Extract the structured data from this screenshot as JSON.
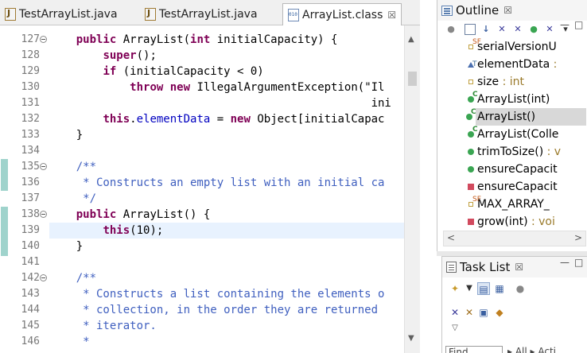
{
  "editor": {
    "tabs": [
      {
        "label": "TestArrayList.java",
        "icon": "java-file-icon",
        "active": false
      },
      {
        "label": "TestArrayList.java",
        "icon": "java-file-icon",
        "active": false
      },
      {
        "label": "ArrayList.class",
        "icon": "class-file-icon",
        "active": true,
        "close_glyph": "☒"
      }
    ],
    "lines": [
      {
        "num": "127",
        "fold": true,
        "tokens": [
          [
            "",
            "    "
          ],
          [
            "kw",
            "public"
          ],
          [
            "",
            " ArrayList("
          ],
          [
            "kw",
            "int"
          ],
          [
            "",
            " initialCapacity) {"
          ]
        ]
      },
      {
        "num": "128",
        "tokens": [
          [
            "",
            "        "
          ],
          [
            "kw",
            "super"
          ],
          [
            "",
            "();"
          ]
        ]
      },
      {
        "num": "129",
        "tokens": [
          [
            "",
            "        "
          ],
          [
            "kw",
            "if"
          ],
          [
            "",
            " (initialCapacity < 0)"
          ]
        ]
      },
      {
        "num": "130",
        "tokens": [
          [
            "",
            "            "
          ],
          [
            "kw",
            "throw"
          ],
          [
            "",
            " "
          ],
          [
            "kw",
            "new"
          ],
          [
            "",
            " IllegalArgumentException(\"Il"
          ]
        ]
      },
      {
        "num": "131",
        "tokens": [
          [
            "",
            "                                                ini"
          ]
        ]
      },
      {
        "num": "132",
        "tokens": [
          [
            "",
            "        "
          ],
          [
            "kw",
            "this"
          ],
          [
            "",
            "."
          ],
          [
            "fld",
            "elementData"
          ],
          [
            "",
            " = "
          ],
          [
            "kw",
            "new"
          ],
          [
            "",
            " Object[initialCapac"
          ]
        ]
      },
      {
        "num": "133",
        "tokens": [
          [
            "",
            "    }"
          ]
        ]
      },
      {
        "num": "134",
        "tokens": [
          [
            "",
            ""
          ]
        ]
      },
      {
        "num": "135",
        "fold": true,
        "tokens": [
          [
            "doc",
            "    /**"
          ]
        ]
      },
      {
        "num": "136",
        "tokens": [
          [
            "doc",
            "     * Constructs an empty list with an initial ca"
          ]
        ]
      },
      {
        "num": "137",
        "tokens": [
          [
            "doc",
            "     */"
          ]
        ]
      },
      {
        "num": "138",
        "fold": true,
        "tokens": [
          [
            "",
            "    "
          ],
          [
            "kw",
            "public"
          ],
          [
            "",
            " ArrayList() {"
          ]
        ]
      },
      {
        "num": "139",
        "current": true,
        "tokens": [
          [
            "",
            "        "
          ],
          [
            "kw",
            "this"
          ],
          [
            "",
            "(10);"
          ]
        ]
      },
      {
        "num": "140",
        "tokens": [
          [
            "",
            "    }"
          ]
        ]
      },
      {
        "num": "141",
        "tokens": [
          [
            "",
            ""
          ]
        ]
      },
      {
        "num": "142",
        "fold": true,
        "tokens": [
          [
            "doc",
            "    /**"
          ]
        ]
      },
      {
        "num": "143",
        "tokens": [
          [
            "doc",
            "     * Constructs a list containing the elements o"
          ]
        ]
      },
      {
        "num": "144",
        "tokens": [
          [
            "doc",
            "     * collection, in the order they are returned "
          ]
        ]
      },
      {
        "num": "145",
        "tokens": [
          [
            "doc",
            "     * iterator."
          ]
        ]
      },
      {
        "num": "146",
        "tokens": [
          [
            "doc",
            "     *"
          ]
        ]
      }
    ],
    "scroll_up": "▲",
    "scroll_down": "▼"
  },
  "outline": {
    "title": "Outline",
    "close_glyph": "☒",
    "minimize_glyph": "—",
    "maximize_glyph": "□",
    "items": [
      {
        "name": "serialVersionU",
        "marker": "prot",
        "sup": "SF",
        "suffix": ""
      },
      {
        "name": "elementData",
        "marker": "tri",
        "sup": "T",
        "suffix": " :"
      },
      {
        "name": "size",
        "marker": "prot",
        "sup": "",
        "suffix": " : int"
      },
      {
        "name": "ArrayList(int)",
        "marker": "pub",
        "sup": "C",
        "suffix": ""
      },
      {
        "name": "ArrayList()",
        "marker": "pub",
        "sup": "C",
        "suffix": "",
        "selected": true
      },
      {
        "name": "ArrayList(Colle",
        "marker": "pub",
        "sup": "C",
        "suffix": ""
      },
      {
        "name": "trimToSize()",
        "marker": "pub",
        "sup": "",
        "suffix": " : v"
      },
      {
        "name": "ensureCapacit",
        "marker": "pub",
        "sup": "",
        "suffix": ""
      },
      {
        "name": "ensureCapacit",
        "marker": "priv",
        "sup": "",
        "suffix": ""
      },
      {
        "name": "MAX_ARRAY_",
        "marker": "prot",
        "sup": "SF",
        "suffix": ""
      },
      {
        "name": "grow(int)",
        "marker": "priv",
        "sup": "",
        "suffix": " : voi"
      }
    ],
    "hscroll_left": "<",
    "hscroll_right": ">"
  },
  "tasklist": {
    "title": "Task List",
    "close_glyph": "☒",
    "minimize_glyph": "—",
    "maximize_glyph": "□",
    "find_label": "Find",
    "find_tail": "▸ All ▸ Acti"
  },
  "colors": {
    "keyword": "#7f0055",
    "field": "#0000c0",
    "javadoc": "#3f5fbf",
    "current_line": "#e8f2fe",
    "change_bar": "#9fd3cc"
  }
}
